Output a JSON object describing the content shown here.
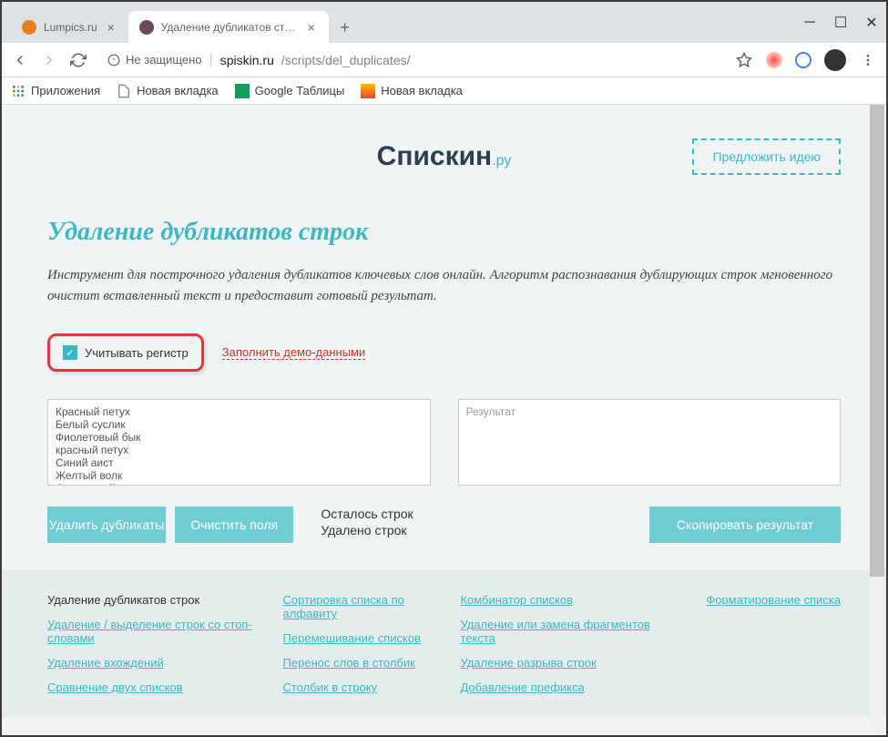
{
  "browser": {
    "tabs": [
      {
        "title": "Lumpics.ru",
        "active": false
      },
      {
        "title": "Удаление дубликатов строк - у",
        "active": true
      }
    ],
    "url_security": "Не защищено",
    "url_host": "spiskin.ru",
    "url_path": "/scripts/del_duplicates/",
    "bookmarks": {
      "apps": "Приложения",
      "new_tab_1": "Новая вкладка",
      "google_sheets": "Google Таблицы",
      "new_tab_2": "Новая вкладка"
    }
  },
  "header": {
    "logo_main": "Спискин",
    "logo_suffix": ".ру",
    "suggest": "Предложить идею"
  },
  "main": {
    "title": "Удаление дубликатов строк",
    "description": "Инструмент для построчного удаления дубликатов ключевых слов онлайн. Алгоритм распознавания дублирующих строк мгновенного очистит вставленный текст и предоставит готовый результат.",
    "checkbox_label": "Учитывать регистр",
    "checkbox_checked": true,
    "demo_link": "Заполнить демо-данными",
    "input_text": "Красный петух\nБелый суслик\nФиолетовый бык\nкрасный петух\nСиний аист\nЖелтый волк\nОранжевый медведь\nСиний аист",
    "result_placeholder": "Результат",
    "btn_delete": "Удалить дубликаты",
    "btn_clear": "Очистить поля",
    "stat_remaining": "Осталось строк",
    "stat_removed": "Удалено строк",
    "btn_copy": "Скопировать результат"
  },
  "footer": {
    "col1": [
      "Удаление дубликатов строк",
      "Удаление / выделение строк со стоп-словами",
      "Удаление вхождений",
      "Сравнение двух списков"
    ],
    "col2": [
      "Сортировка списка по алфавиту",
      "Перемешивание списков",
      "Перенос слов в столбик",
      "Столбик в строку"
    ],
    "col3": [
      "Комбинатор списков",
      "Удаление или замена фрагментов текста",
      "Удаление разрыва строк",
      "Добавление префикса"
    ],
    "col4": [
      "Форматирование списка"
    ]
  }
}
